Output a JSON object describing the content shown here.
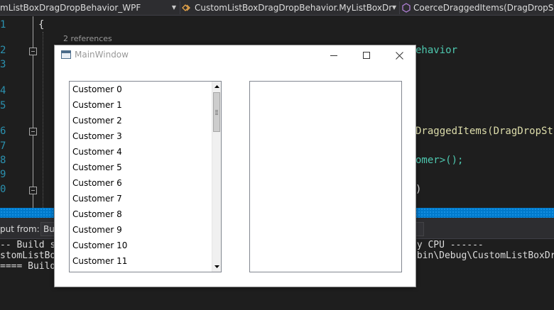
{
  "nav": {
    "project": "mListBoxDragDropBehavior_WPF",
    "class": "CustomListBoxDragDropBehavior.MyListBoxDragDr",
    "member": "CoerceDraggedItems(DragDropState s"
  },
  "editor": {
    "line_numbers": [
      "1",
      "2",
      "3",
      "4",
      "5",
      "6",
      "7",
      "8",
      "9",
      "0"
    ],
    "code_lines": [
      "{",
      "ehavior",
      "DraggedItems(DragDropSt",
      "omer>();",
      ")"
    ],
    "codelens": "2 references"
  },
  "output": {
    "label": "put from:",
    "source": "Bui",
    "lines": [
      "-- Build st",
      "stomListBox",
      "==== Build:",
      "ny CPU ------",
      "\\bin\\Debug\\CustomListBoxDrag"
    ]
  },
  "window": {
    "title": "MainWindow",
    "left_list": {
      "items": [
        "Customer 0",
        "Customer 1",
        "Customer 2",
        "Customer 3",
        "Customer 4",
        "Customer 5",
        "Customer 6",
        "Customer 7",
        "Customer 8",
        "Customer 9",
        "Customer 10",
        "Customer 11"
      ]
    },
    "right_list": {
      "items": []
    }
  },
  "colors": {
    "line_number": "#2b91af",
    "accent": "#007acc",
    "editor_bg": "#1e1e1e"
  }
}
